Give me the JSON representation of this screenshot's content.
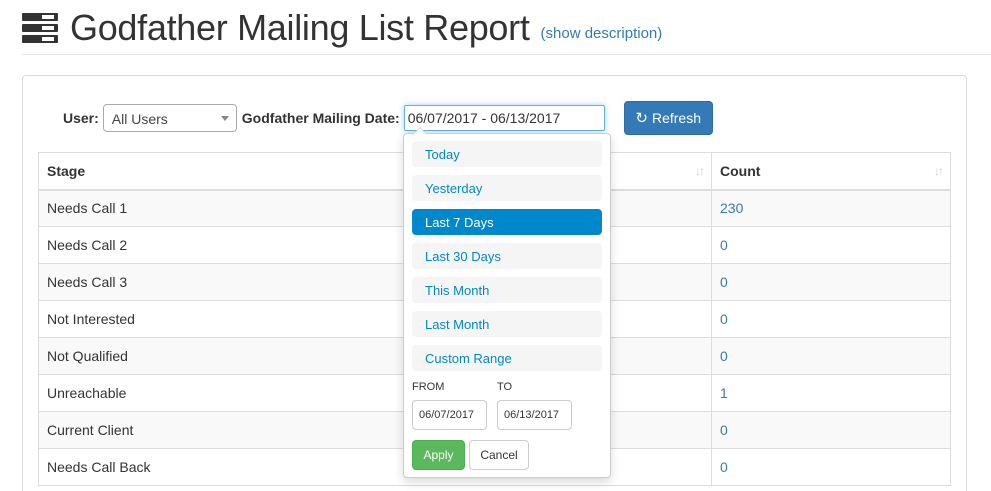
{
  "header": {
    "icon": "list-report-icon",
    "title": "Godfather Mailing List Report",
    "description_link": "(show description)"
  },
  "filters": {
    "user_label": "User:",
    "user_value": "All Users",
    "date_label": "Godfather Mailing Date:",
    "date_value": "06/07/2017 - 06/13/2017",
    "refresh_label": "Refresh",
    "refresh_icon": "refresh-icon"
  },
  "table": {
    "columns": [
      "Stage",
      "Count"
    ],
    "rows": [
      {
        "stage": "Needs Call 1",
        "count": "230"
      },
      {
        "stage": "Needs Call 2",
        "count": "0"
      },
      {
        "stage": "Needs Call 3",
        "count": "0"
      },
      {
        "stage": "Not Interested",
        "count": "0"
      },
      {
        "stage": "Not Qualified",
        "count": "0"
      },
      {
        "stage": "Unreachable",
        "count": "1"
      },
      {
        "stage": "Current Client",
        "count": "0"
      },
      {
        "stage": "Needs Call Back",
        "count": "0"
      }
    ]
  },
  "daterange": {
    "ranges": [
      "Today",
      "Yesterday",
      "Last 7 Days",
      "Last 30 Days",
      "This Month",
      "Last Month",
      "Custom Range"
    ],
    "active_range": "Last 7 Days",
    "from_label": "FROM",
    "to_label": "TO",
    "from_value": "06/07/2017",
    "to_value": "06/13/2017",
    "apply_label": "Apply",
    "cancel_label": "Cancel"
  },
  "colors": {
    "primary": "#337ab7",
    "range_active": "#0088cc",
    "apply": "#5cb85c"
  }
}
